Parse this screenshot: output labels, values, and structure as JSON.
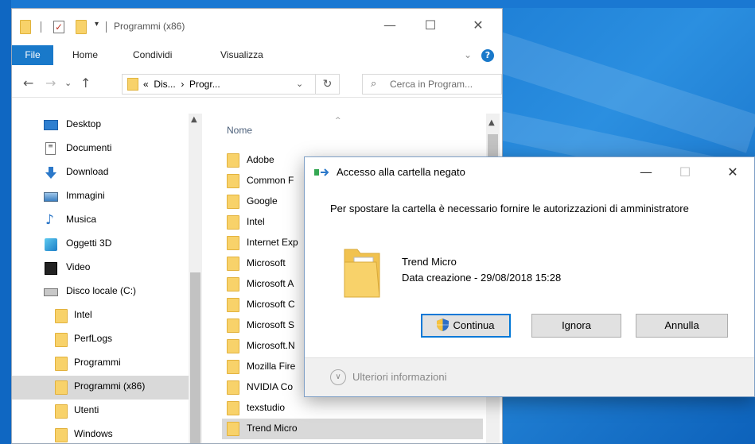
{
  "window": {
    "title": "Programmi (x86)",
    "controls": {
      "minimize": "—",
      "maximize": "☐",
      "close": "✕"
    }
  },
  "ribbon": {
    "tabs": [
      "File",
      "Home",
      "Condividi",
      "Visualizza"
    ],
    "chevron": "⌄",
    "help": "?"
  },
  "addressbar": {
    "back": "←",
    "forward": "→",
    "recent": "⌄",
    "up": "↑",
    "path": "«  Dis...  ›  Progr...",
    "dropdown": "⌄",
    "refresh": "↻",
    "search_placeholder": "Cerca in Program..."
  },
  "nav": {
    "items": [
      {
        "label": "Desktop",
        "icon": "desktop-icon"
      },
      {
        "label": "Documenti",
        "icon": "document-icon"
      },
      {
        "label": "Download",
        "icon": "download-icon"
      },
      {
        "label": "Immagini",
        "icon": "pictures-icon"
      },
      {
        "label": "Musica",
        "icon": "music-icon"
      },
      {
        "label": "Oggetti 3D",
        "icon": "3d-objects-icon"
      },
      {
        "label": "Video",
        "icon": "video-icon"
      },
      {
        "label": "Disco locale (C:)",
        "icon": "drive-icon"
      },
      {
        "label": "Intel",
        "icon": "folder-icon"
      },
      {
        "label": "PerfLogs",
        "icon": "folder-icon"
      },
      {
        "label": "Programmi",
        "icon": "folder-icon"
      },
      {
        "label": "Programmi (x86)",
        "icon": "folder-icon",
        "selected": true
      },
      {
        "label": "Utenti",
        "icon": "folder-icon"
      },
      {
        "label": "Windows",
        "icon": "folder-icon"
      }
    ]
  },
  "files": {
    "column_header": "Nome",
    "rows": [
      {
        "label": "Adobe"
      },
      {
        "label": "Common F"
      },
      {
        "label": "Google"
      },
      {
        "label": "Intel"
      },
      {
        "label": "Internet Exp"
      },
      {
        "label": "Microsoft"
      },
      {
        "label": "Microsoft A"
      },
      {
        "label": "Microsoft C"
      },
      {
        "label": "Microsoft S"
      },
      {
        "label": "Microsoft.N"
      },
      {
        "label": "Mozilla Fire"
      },
      {
        "label": "NVIDIA Co"
      },
      {
        "label": "texstudio"
      },
      {
        "label": "Trend Micro",
        "selected": true
      }
    ]
  },
  "dialog": {
    "title": "Accesso alla cartella negato",
    "controls": {
      "minimize": "—",
      "maximize": "☐",
      "close": "✕"
    },
    "message": "Per spostare la cartella è necessario fornire le autorizzazioni di amministratore",
    "item_name": "Trend Micro",
    "item_date": "Data creazione - 29/08/2018 15:28",
    "buttons": {
      "continue": "Continua",
      "skip": "Ignora",
      "cancel": "Annulla"
    },
    "more_info": "Ulteriori informazioni"
  },
  "colors": {
    "accent": "#0078d7",
    "file_tab": "#1979ca",
    "folder": "#f8d26a",
    "selection": "#d9d9d9"
  }
}
